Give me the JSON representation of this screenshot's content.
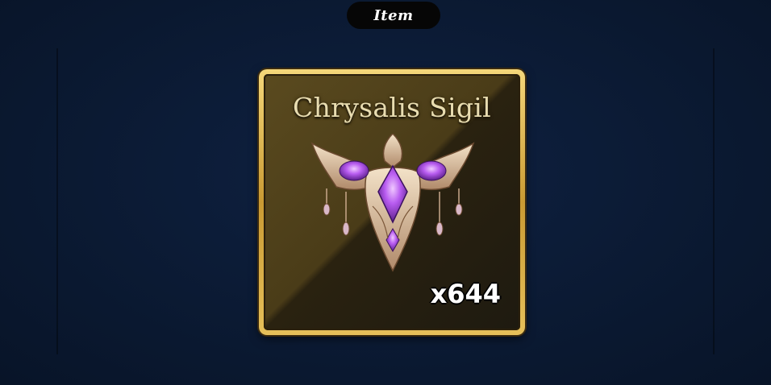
{
  "header": {
    "label": "Item"
  },
  "item_card": {
    "name": "Chrysalis Sigil",
    "quantity": "x644",
    "icon": "chrysalis-sigil-icon"
  },
  "colors": {
    "background": "#0b1a33",
    "frame_gold": "#e6c05a",
    "gem_purple": "#a855f7",
    "title_text": "#e8dcb0"
  }
}
